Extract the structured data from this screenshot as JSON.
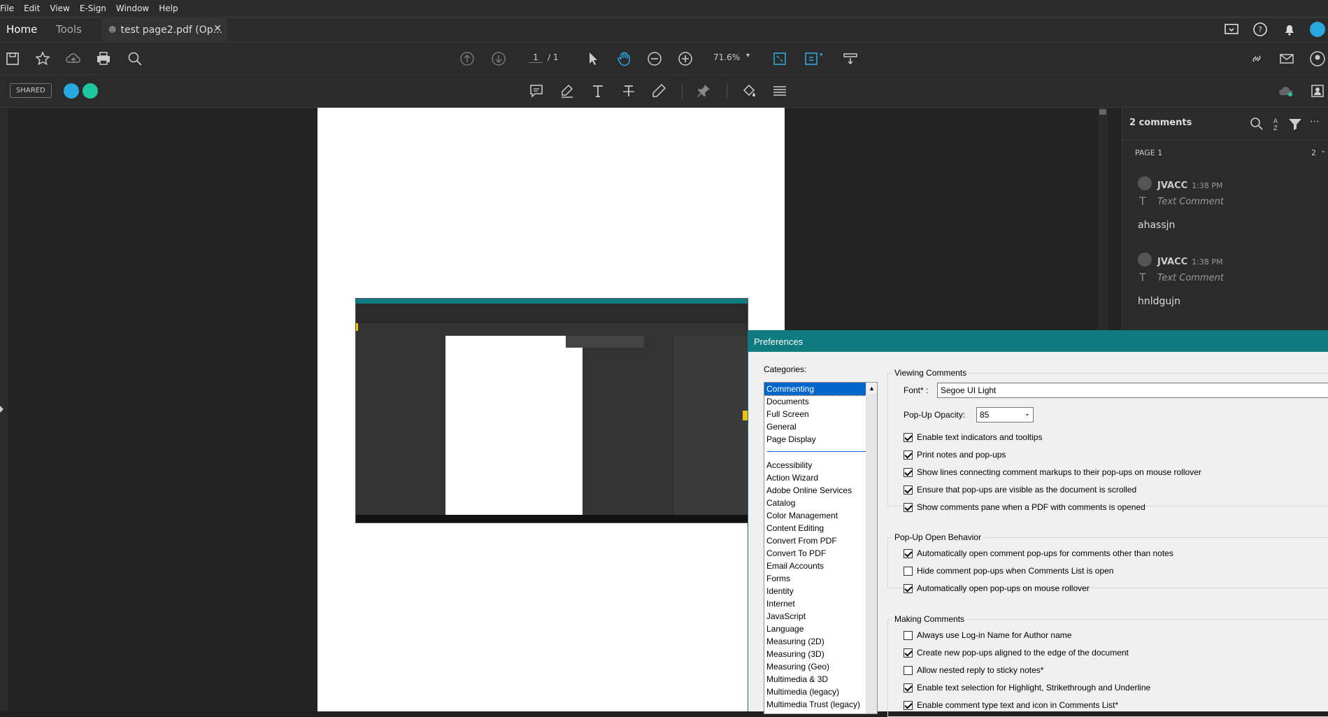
{
  "menu": [
    "File",
    "Edit",
    "View",
    "E-Sign",
    "Window",
    "Help"
  ],
  "tabs": {
    "home": "Home",
    "tools": "Tools",
    "document": "test page2.pdf (Op..."
  },
  "toolbar": {
    "page_current": "1",
    "page_total": "/ 1",
    "zoom": "71.6%"
  },
  "badges": {
    "shared": "SHARED"
  },
  "comments": {
    "header": "2 comments",
    "section": "PAGE 1",
    "section_count": "2",
    "items": [
      {
        "author": "JVACC",
        "time": "1:38 PM",
        "type": "Text Comment",
        "body": "ahassjn"
      },
      {
        "author": "JVACC",
        "time": "1:38 PM",
        "type": "Text Comment",
        "body": "hnldgujn"
      }
    ]
  },
  "prefs": {
    "title": "Preferences",
    "categories_label": "Categories:",
    "categories_top": [
      "Commenting",
      "Documents",
      "Full Screen",
      "General",
      "Page Display"
    ],
    "categories_rest": [
      "Accessibility",
      "Action Wizard",
      "Adobe Online Services",
      "Catalog",
      "Color Management",
      "Content Editing",
      "Convert From PDF",
      "Convert To PDF",
      "Email Accounts",
      "Forms",
      "Identity",
      "Internet",
      "JavaScript",
      "Language",
      "Measuring (2D)",
      "Measuring (3D)",
      "Measuring (Geo)",
      "Multimedia & 3D",
      "Multimedia (legacy)",
      "Multimedia Trust (legacy)"
    ],
    "viewing": {
      "legend": "Viewing Comments",
      "font_label": "Font* :",
      "font_value": "Segoe UI Light",
      "opacity_label": "Pop-Up Opacity:",
      "opacity_value": "85",
      "options": [
        {
          "label": "Enable text indicators and tooltips",
          "checked": true
        },
        {
          "label": "Print notes and pop-ups",
          "checked": true
        },
        {
          "label": "Show lines connecting comment markups to their pop-ups on mouse rollover",
          "checked": true
        },
        {
          "label": "Ensure that pop-ups are visible as the document is scrolled",
          "checked": true
        },
        {
          "label": "Show comments pane when a PDF with comments is opened",
          "checked": true
        }
      ]
    },
    "popup": {
      "legend": "Pop-Up Open Behavior",
      "options": [
        {
          "label": "Automatically open comment pop-ups for comments other than notes",
          "checked": true
        },
        {
          "label": "Hide comment pop-ups when Comments List is open",
          "checked": false
        },
        {
          "label": "Automatically open pop-ups on mouse rollover",
          "checked": true
        }
      ]
    },
    "making": {
      "legend": "Making Comments",
      "options": [
        {
          "label": "Always use Log-in Name for Author name",
          "checked": false
        },
        {
          "label": "Create new pop-ups aligned to the edge of the document",
          "checked": true
        },
        {
          "label": "Allow nested reply to sticky notes*",
          "checked": false
        },
        {
          "label": "Enable text selection for Highlight, Strikethrough and Underline",
          "checked": true
        },
        {
          "label": "Enable comment type text and icon in Comments List*",
          "checked": true
        }
      ]
    }
  },
  "colors": {
    "accent": "#0d7b7f",
    "selection": "#0066cc",
    "avatar1": "#29a8e0",
    "avatar2": "#1ec8a0"
  }
}
